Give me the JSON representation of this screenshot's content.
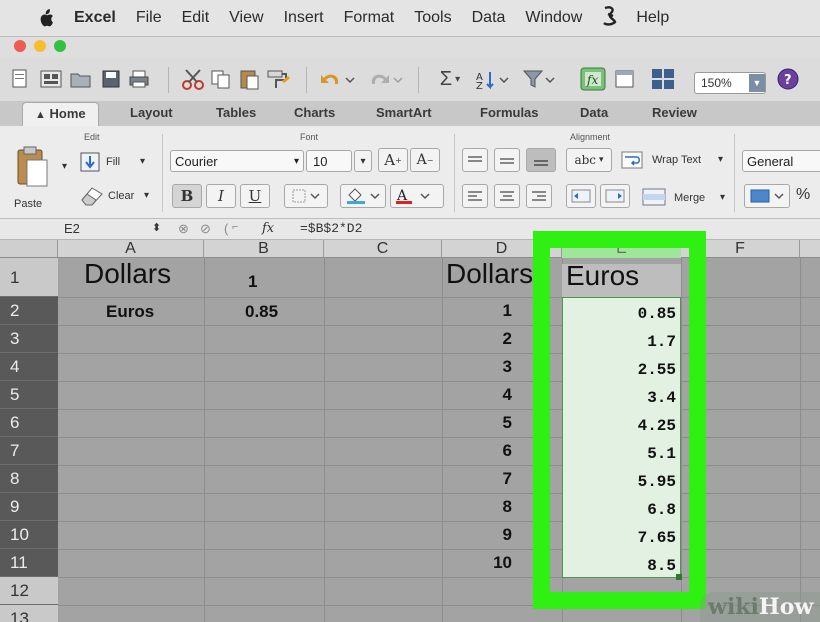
{
  "menubar": {
    "app": "Excel",
    "items": [
      "File",
      "Edit",
      "View",
      "Insert",
      "Format",
      "Tools",
      "Data",
      "Window",
      "Help"
    ]
  },
  "toolbar": {
    "zoom": "150%"
  },
  "ribbon_tabs": [
    "Home",
    "Layout",
    "Tables",
    "Charts",
    "SmartArt",
    "Formulas",
    "Data",
    "Review"
  ],
  "ribbon": {
    "groups": {
      "edit": "Edit",
      "font": "Font",
      "alignment": "Alignment"
    },
    "paste": "Paste",
    "fill": "Fill",
    "clear": "Clear",
    "font_name": "Courier",
    "font_size": "10",
    "wrap_text": "Wrap Text",
    "merge": "Merge",
    "number_format": "General",
    "percent": "%",
    "abc": "abc",
    "bold": "B",
    "italic": "I",
    "underline": "U"
  },
  "formula_bar": {
    "cell_ref": "E2",
    "fx": "fx",
    "formula": "=$B$2*D2"
  },
  "grid": {
    "columns": [
      "A",
      "B",
      "C",
      "D",
      "E",
      "F"
    ],
    "rows": [
      "1",
      "2",
      "3",
      "4",
      "5",
      "6",
      "7",
      "8",
      "9",
      "10",
      "11",
      "12",
      "13"
    ],
    "A1": "Dollars",
    "B1": "1",
    "A2": "Euros",
    "B2": "0.85",
    "D1": "Dollars",
    "E1": "Euros",
    "D_values": [
      "1",
      "2",
      "3",
      "4",
      "5",
      "6",
      "7",
      "8",
      "9",
      "10"
    ],
    "E_values": [
      "0.85",
      "1.7",
      "2.55",
      "3.4",
      "4.25",
      "5.1",
      "5.95",
      "6.8",
      "7.65",
      "8.5"
    ]
  },
  "watermark": {
    "part1": "wiki",
    "part2": "How"
  },
  "colors": {
    "highlight": "#2ff012",
    "selection": "#e2f1e2",
    "row_header": "#595959"
  }
}
